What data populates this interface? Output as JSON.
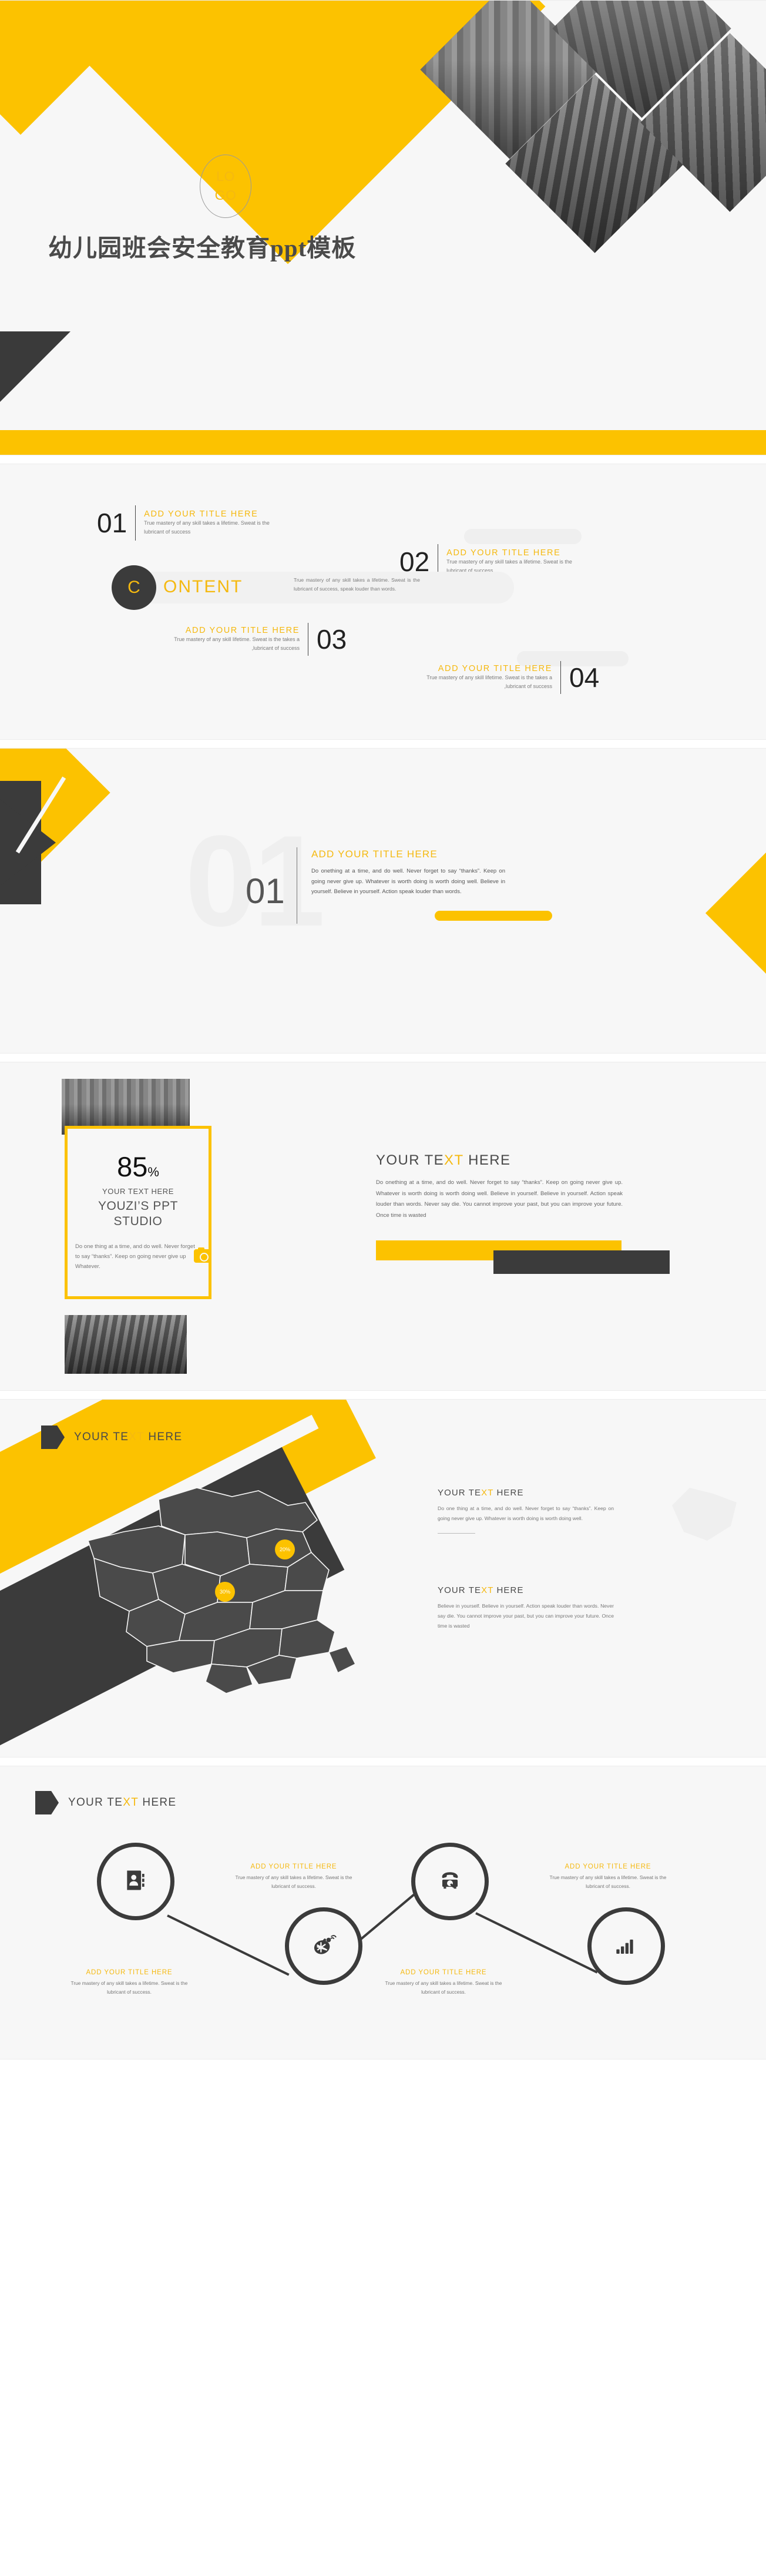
{
  "slide1": {
    "logo_line1": "LO",
    "logo_line2": "GO",
    "title": "幼儿园班会安全教育ppt模板"
  },
  "slide2": {
    "center": {
      "initial": "C",
      "word": "ONTENT",
      "desc": "True mastery of any skill takes a lifetime. Sweat is the lubricant of success, speak louder than words."
    },
    "items": [
      {
        "num": "01",
        "title": "ADD YOUR TITLE HERE",
        "body": "True mastery of any skill takes a lifetime. Sweat is the lubricant of success"
      },
      {
        "num": "02",
        "title": "ADD YOUR TITLE HERE",
        "body": "True mastery of any skill takes a lifetime. Sweat is the lubricant of success"
      },
      {
        "num": "03",
        "title": "ADD YOUR TITLE HERE",
        "body": "True mastery of any skill lifetime. Sweat is the takes a ,lubricant of success"
      },
      {
        "num": "04",
        "title": "ADD YOUR TITLE HERE",
        "body": "True mastery of any skill lifetime. Sweat is the takes a ,lubricant of success"
      }
    ]
  },
  "slide3": {
    "ghost_number": "01",
    "number": "01",
    "title": "ADD YOUR TITLE HERE",
    "body": "Do onething at a time, and do well. Never forget to say “thanks”. Keep on going never give up. Whatever is worth doing is worth doing well. Believe in yourself. Believe in yourself. Action speak louder than words."
  },
  "slide4": {
    "percent_value": "85",
    "percent_symbol": "%",
    "sub_label": "YOUR TEXT HERE",
    "brand_line1": "YOUZI’S PPT",
    "brand_line2": "STUDIO",
    "box_body": "Do one thing at a time, and do well. Never forget to say “thanks”. Keep on going never give up Whatever.",
    "heading_pre": "YOUR TE",
    "heading_mid": "XT",
    "heading_post": " HERE",
    "body": "Do onething at a time, and do well. Never forget to say “thanks”. Keep on going never give up. Whatever is worth doing is worth doing well. Believe in yourself. Believe in yourself. Action speak louder than words. Never say die. You cannot improve your past, but you can improve your future. Once time is wasted"
  },
  "slide5": {
    "header_pre": "YOUR TE",
    "header_mid": "XT",
    "header_post": " HERE",
    "badges": [
      "20%",
      "30%"
    ],
    "columns": [
      {
        "title_pre": "YOUR TE",
        "title_mid": "XT",
        "title_post": " HERE",
        "body": "Do one thing at a time, and do well. Never forget to say “thanks”. Keep on going never give up. Whatever is worth doing is worth doing well."
      },
      {
        "title_pre": "YOUR TE",
        "title_mid": "XT",
        "title_post": " HERE",
        "body": "Believe in yourself. Believe in yourself. Action speak louder than words. Never say die. You cannot improve your past, but you can improve your future. Once time is wasted"
      }
    ]
  },
  "slide6": {
    "header_pre": "YOUR TE",
    "header_mid": "XT",
    "header_post": " HERE",
    "nodes": [
      {
        "icon": "address-book-icon"
      },
      {
        "icon": "satellite-dish-icon"
      },
      {
        "icon": "telephone-icon"
      },
      {
        "icon": "bar-chart-icon"
      }
    ],
    "captions": [
      {
        "title": "ADD YOUR TITLE HERE",
        "body": "True mastery of any skill takes a lifetime. Sweat is the lubricant of success."
      },
      {
        "title": "ADD YOUR TITLE HERE",
        "body": "True mastery of any skill takes a lifetime. Sweat is the lubricant of success."
      },
      {
        "title": "ADD YOUR TITLE HERE",
        "body": "True mastery of any skill takes a lifetime. Sweat is the lubricant of success."
      },
      {
        "title": "ADD YOUR TITLE HERE",
        "body": "True mastery of any skill takes a lifetime. Sweat is the lubricant of success."
      }
    ]
  },
  "colors": {
    "accent_yellow": "#fcc200",
    "title_yellow": "#f5b910",
    "dark": "#3b3b3b",
    "slide_bg": "#f7f7f7"
  }
}
